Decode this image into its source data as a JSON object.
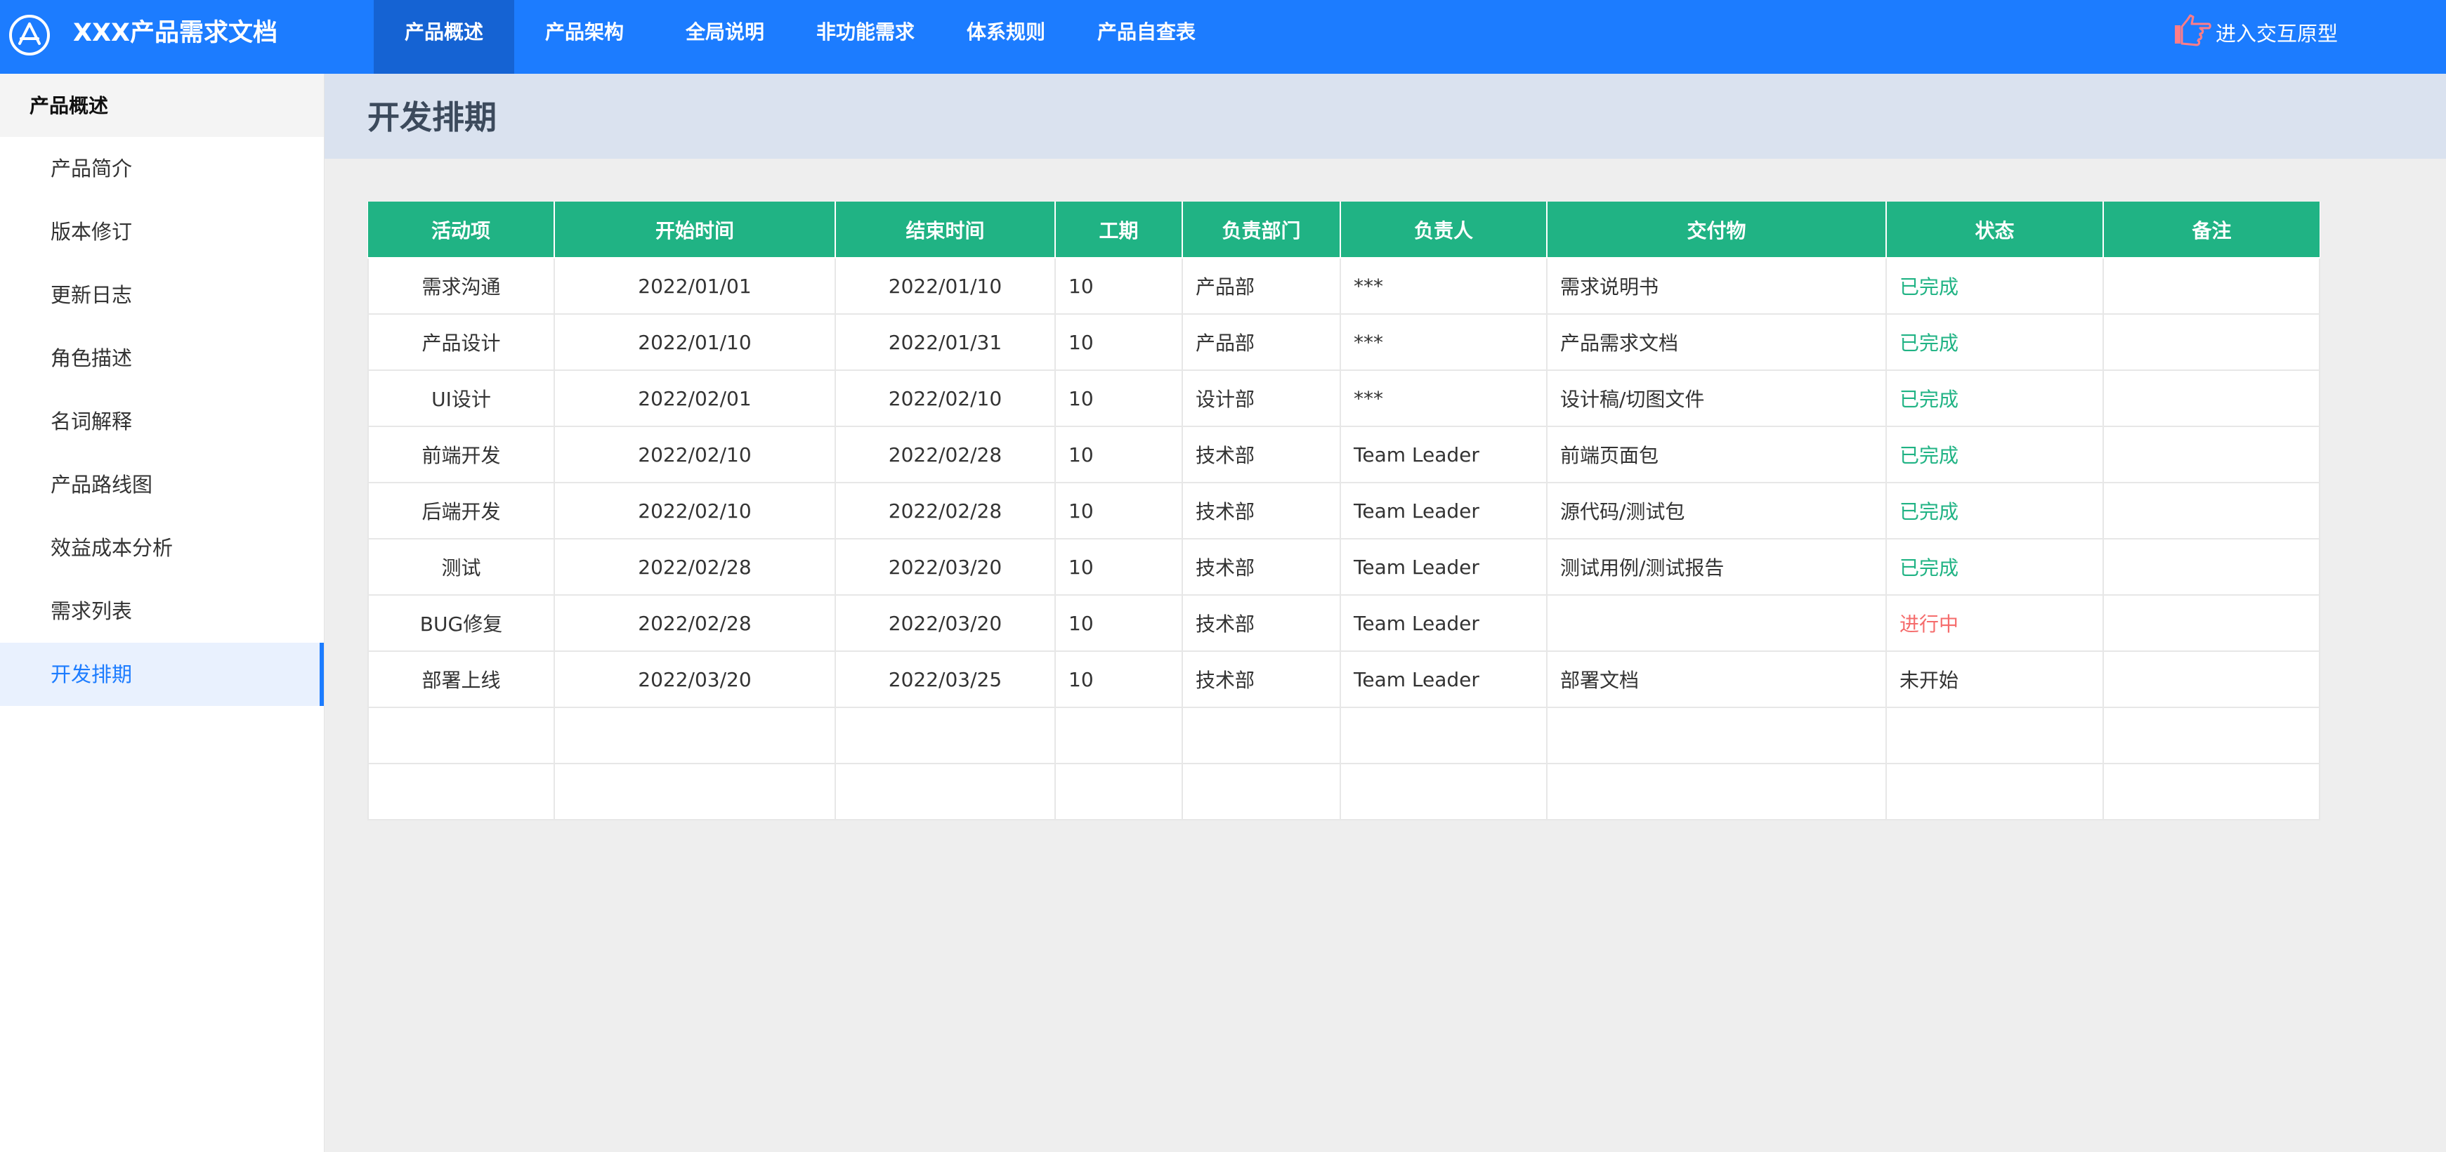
{
  "app": {
    "title": "XXX产品需求文档"
  },
  "nav": {
    "items": [
      {
        "label": "产品概述",
        "active": true
      },
      {
        "label": "产品架构",
        "active": false
      },
      {
        "label": "全局说明",
        "active": false
      },
      {
        "label": "非功能需求",
        "active": false
      },
      {
        "label": "体系规则",
        "active": false
      },
      {
        "label": "产品自查表",
        "active": false
      }
    ],
    "prototype_link": {
      "label": "进入交互原型",
      "icon": "pointing-hand-icon"
    }
  },
  "sidebar": {
    "header": "产品概述",
    "items": [
      {
        "label": "产品简介",
        "active": false
      },
      {
        "label": "版本修订",
        "active": false
      },
      {
        "label": "更新日志",
        "active": false
      },
      {
        "label": "角色描述",
        "active": false
      },
      {
        "label": "名词解释",
        "active": false
      },
      {
        "label": "产品路线图",
        "active": false
      },
      {
        "label": "效益成本分析",
        "active": false
      },
      {
        "label": "需求列表",
        "active": false
      },
      {
        "label": "开发排期",
        "active": true
      }
    ]
  },
  "page": {
    "title": "开发排期"
  },
  "table": {
    "columns": [
      "活动项",
      "开始时间",
      "结束时间",
      "工期",
      "负责部门",
      "负责人",
      "交付物",
      "状态",
      "备注"
    ],
    "rows": [
      {
        "activity": "需求沟通",
        "start": "2022/01/01",
        "end": "2022/01/10",
        "duration": "10",
        "dept": "产品部",
        "owner": "***",
        "deliverable": "需求说明书",
        "status": "已完成",
        "status_type": "done",
        "note": ""
      },
      {
        "activity": "产品设计",
        "start": "2022/01/10",
        "end": "2022/01/31",
        "duration": "10",
        "dept": "产品部",
        "owner": "***",
        "deliverable": "产品需求文档",
        "status": "已完成",
        "status_type": "done",
        "note": ""
      },
      {
        "activity": "UI设计",
        "start": "2022/02/01",
        "end": "2022/02/10",
        "duration": "10",
        "dept": "设计部",
        "owner": "***",
        "deliverable": "设计稿/切图文件",
        "status": "已完成",
        "status_type": "done",
        "note": ""
      },
      {
        "activity": "前端开发",
        "start": "2022/02/10",
        "end": "2022/02/28",
        "duration": "10",
        "dept": "技术部",
        "owner": "Team Leader",
        "deliverable": "前端页面包",
        "status": "已完成",
        "status_type": "done",
        "note": ""
      },
      {
        "activity": "后端开发",
        "start": "2022/02/10",
        "end": "2022/02/28",
        "duration": "10",
        "dept": "技术部",
        "owner": "Team Leader",
        "deliverable": "源代码/测试包",
        "status": "已完成",
        "status_type": "done",
        "note": ""
      },
      {
        "activity": "测试",
        "start": "2022/02/28",
        "end": "2022/03/20",
        "duration": "10",
        "dept": "技术部",
        "owner": "Team Leader",
        "deliverable": "测试用例/测试报告",
        "status": "已完成",
        "status_type": "done",
        "note": ""
      },
      {
        "activity": "BUG修复",
        "start": "2022/02/28",
        "end": "2022/03/20",
        "duration": "10",
        "dept": "技术部",
        "owner": "Team Leader",
        "deliverable": "",
        "status": "进行中",
        "status_type": "doing",
        "note": ""
      },
      {
        "activity": "部署上线",
        "start": "2022/03/20",
        "end": "2022/03/25",
        "duration": "10",
        "dept": "技术部",
        "owner": "Team Leader",
        "deliverable": "部署文档",
        "status": "未开始",
        "status_type": "todo",
        "note": ""
      },
      {
        "activity": "",
        "start": "",
        "end": "",
        "duration": "",
        "dept": "",
        "owner": "",
        "deliverable": "",
        "status": "",
        "status_type": "",
        "note": ""
      },
      {
        "activity": "",
        "start": "",
        "end": "",
        "duration": "",
        "dept": "",
        "owner": "",
        "deliverable": "",
        "status": "",
        "status_type": "",
        "note": ""
      }
    ]
  },
  "colors": {
    "brand": "#1c7cff",
    "nav_active": "#1563d3",
    "table_header": "#20b384",
    "status_done": "#20b384",
    "status_doing": "#f56c6c",
    "status_todo": "#333333"
  }
}
